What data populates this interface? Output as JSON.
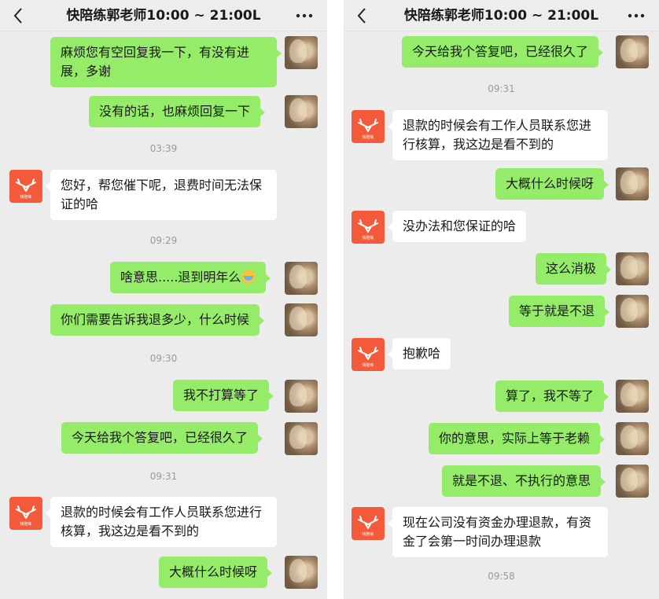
{
  "left": {
    "title": "快陪练郭老师10:00 ~ 21:00L",
    "messages": [
      {
        "kind": "out",
        "text": "麻烦您有空回复我一下，有没有进展，多谢"
      },
      {
        "kind": "out",
        "text": "没有的话，也麻烦回复一下"
      },
      {
        "kind": "time",
        "text": "03:39"
      },
      {
        "kind": "in",
        "text": "您好，帮您催下呢，退费时间无法保证的哈"
      },
      {
        "kind": "time",
        "text": "09:29"
      },
      {
        "kind": "out",
        "text": "啥意思.....退到明年么"
      },
      {
        "kind": "out",
        "text": "你们需要告诉我退多少，什么时候"
      },
      {
        "kind": "time",
        "text": "09:30"
      },
      {
        "kind": "out",
        "text": "我不打算等了"
      },
      {
        "kind": "out",
        "text": "今天给我个答复吧，已经很久了"
      },
      {
        "kind": "time",
        "text": "09:31"
      },
      {
        "kind": "in",
        "text": "退款的时候会有工作人员联系您进行核算，我这边是看不到的"
      },
      {
        "kind": "out",
        "text": "大概什么时候呀"
      }
    ]
  },
  "right": {
    "title": "快陪练郭老师10:00 ~ 21:00L",
    "messages": [
      {
        "kind": "out",
        "text": "今天给我个答复吧，已经很久了"
      },
      {
        "kind": "time",
        "text": "09:31"
      },
      {
        "kind": "in",
        "text": "退款的时候会有工作人员联系您进行核算，我这边是看不到的"
      },
      {
        "kind": "out",
        "text": "大概什么时候呀"
      },
      {
        "kind": "in",
        "text": "没办法和您保证的哈"
      },
      {
        "kind": "out",
        "text": "这么消极"
      },
      {
        "kind": "out",
        "text": "等于就是不退"
      },
      {
        "kind": "in",
        "text": "抱歉哈"
      },
      {
        "kind": "out",
        "text": "算了，我不等了"
      },
      {
        "kind": "out",
        "text": "你的意思，实际上等于老赖"
      },
      {
        "kind": "out",
        "text": "就是不退、不执行的意思"
      },
      {
        "kind": "in",
        "text": "现在公司没有资金办理退款，有资金了会第一时间办理退款"
      },
      {
        "kind": "time",
        "text": "09:58"
      }
    ]
  },
  "agent_logo_text": "快陪练",
  "icons": {
    "back": "chevron-left-icon",
    "more": "more-dots-icon",
    "emoji": "grinning-tears-emoji"
  },
  "colors": {
    "outgoing_bubble": "#95ec69",
    "incoming_bubble": "#ffffff",
    "background": "#ececec",
    "agent_avatar": "#f35a3b"
  }
}
